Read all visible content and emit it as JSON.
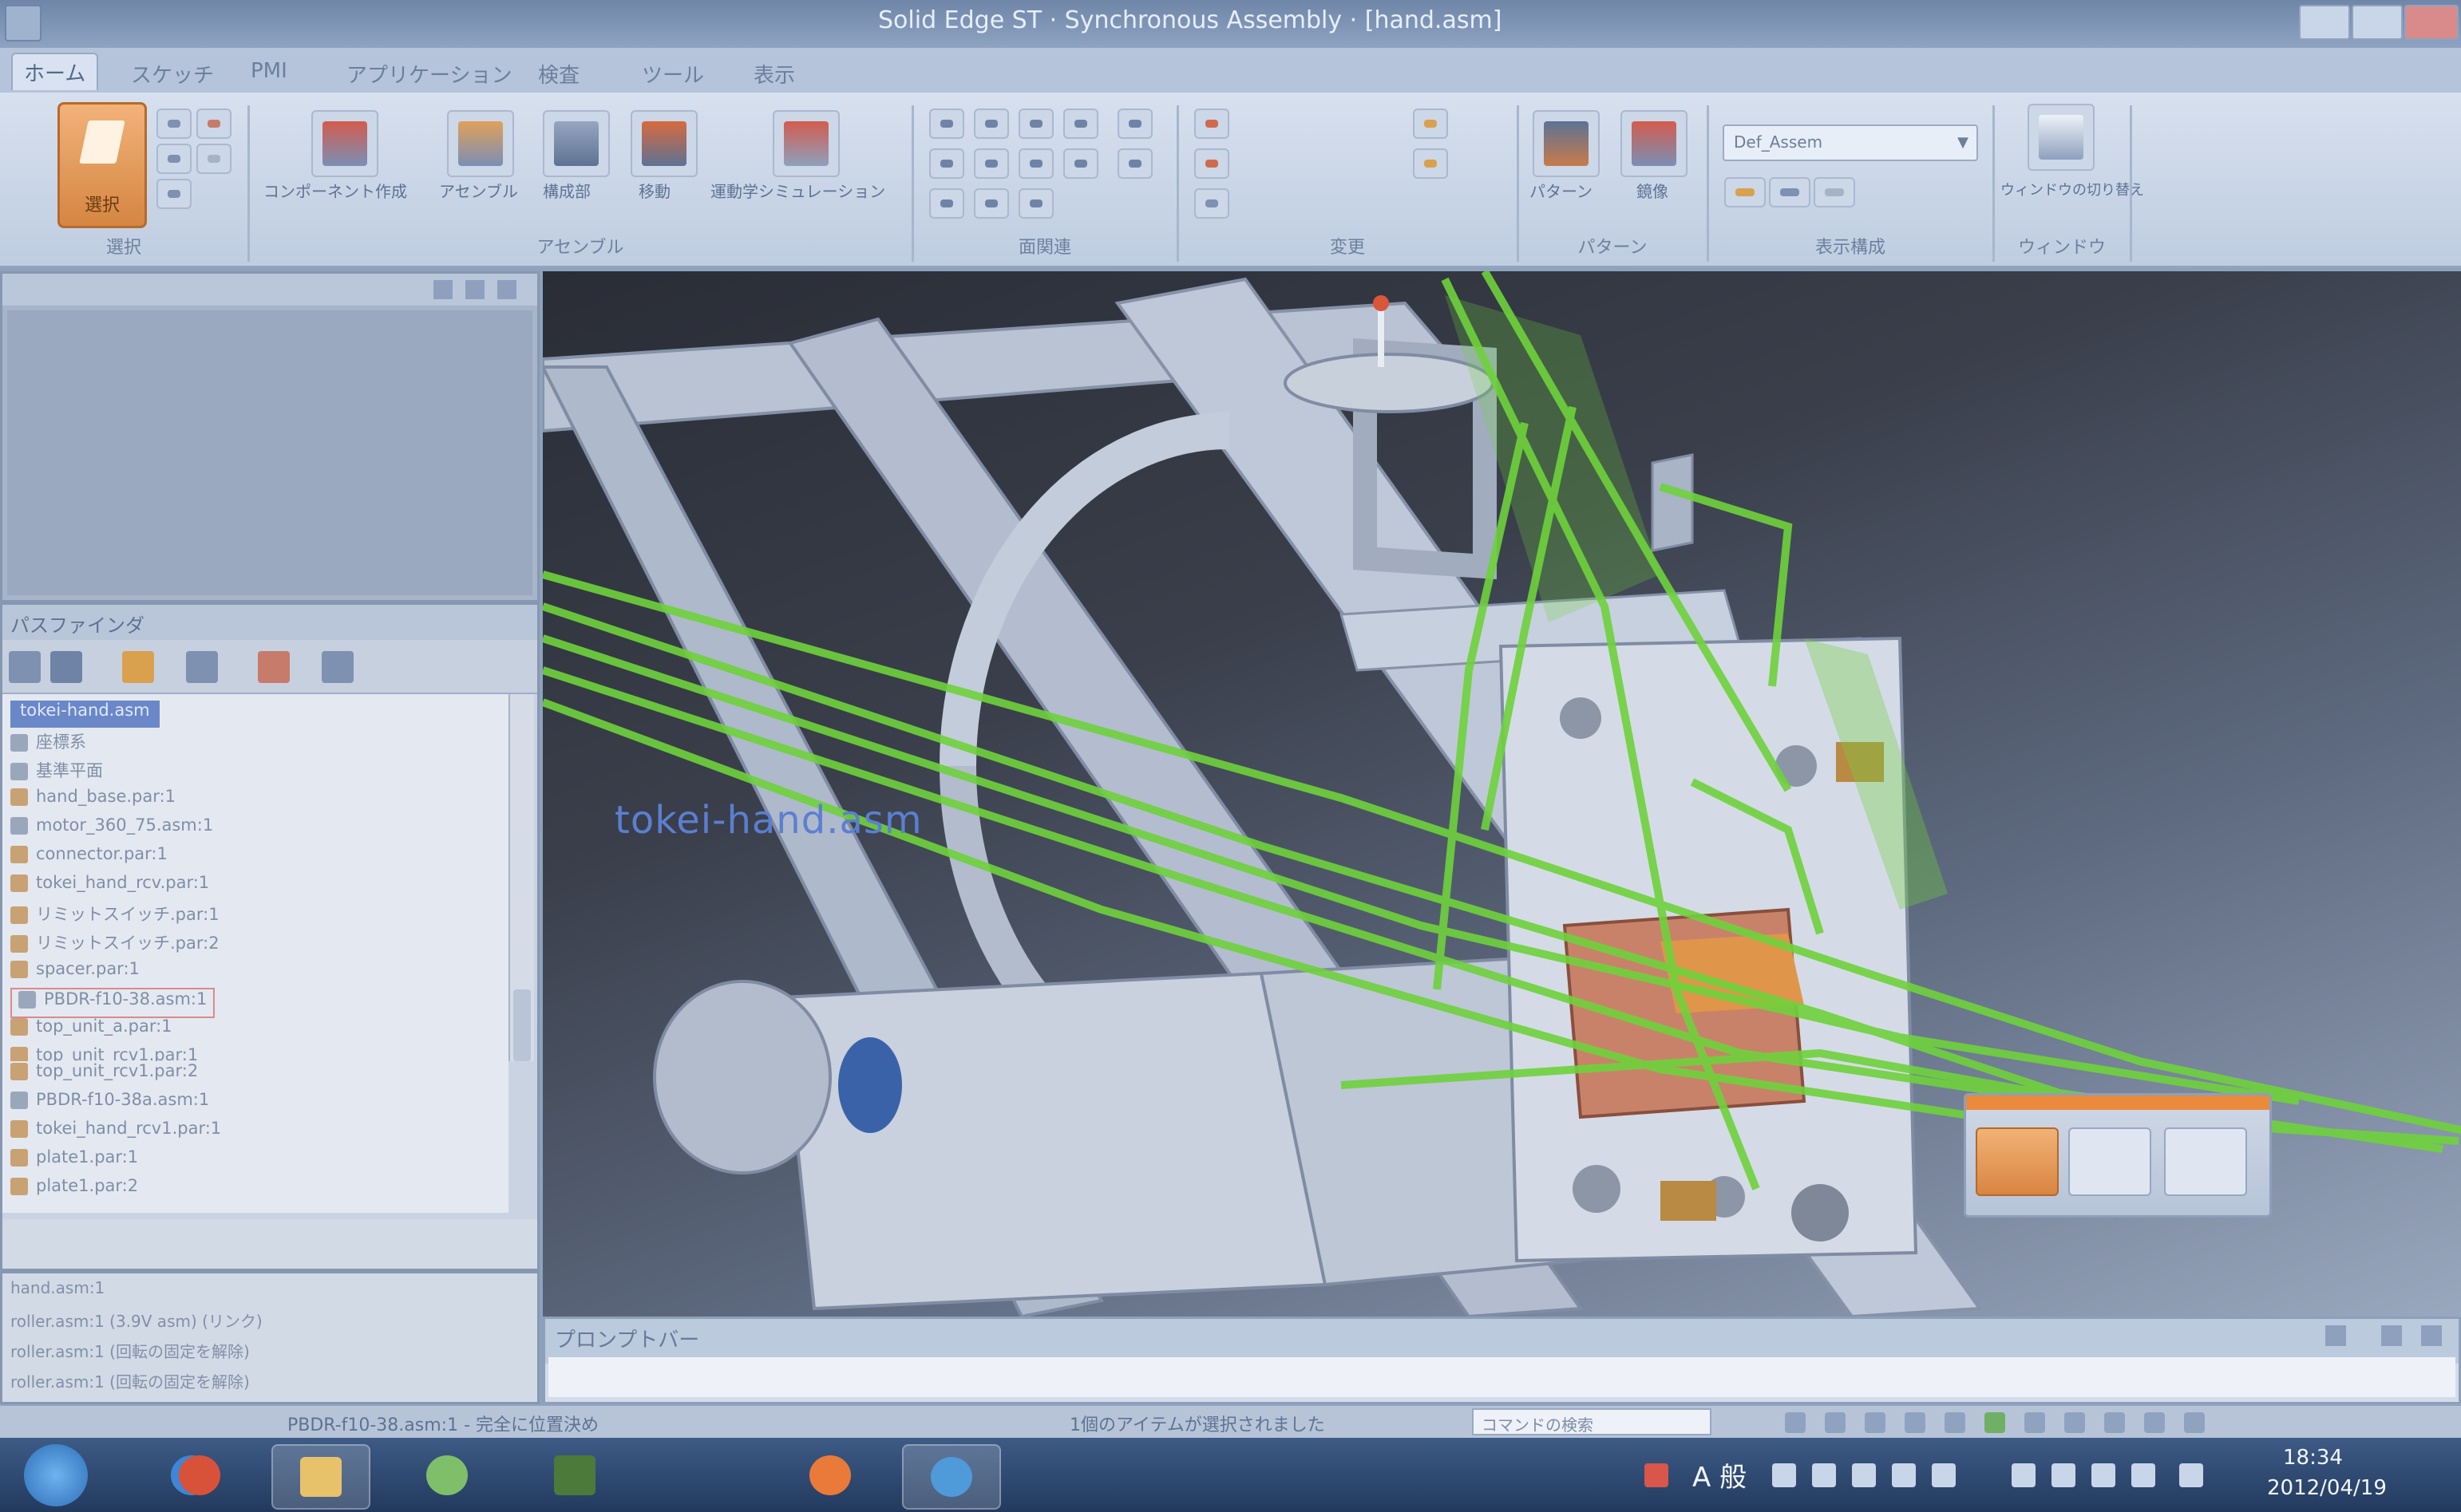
{
  "window": {
    "title": "Solid Edge ST · Synchronous Assembly · [hand.asm]"
  },
  "ribbon": {
    "tabs": [
      "ホーム",
      "スケッチ",
      "PMI",
      "アプリケーション",
      "検査",
      "ツール",
      "表示"
    ],
    "groups": {
      "select": "選択",
      "assemble": "アセンブル",
      "modify": "面関連",
      "pattern": "パターン",
      "display": "表示構成",
      "window": "ウィンドウ",
      "shape": "変更"
    },
    "buttons": {
      "select": "選択",
      "component_structure": "コンポーネント作成",
      "assemble": "アセンブル",
      "sub_assembly": "構成部",
      "move": "移動",
      "motion_simulation": "運動学シミュレーション",
      "pattern": "パターン",
      "mirror": "鏡像",
      "switch_window": "ウィンドウの切り替え"
    },
    "combo_value": "Def_Assem"
  },
  "pathfinder": {
    "header": "パスファインダ",
    "tree": [
      {
        "label": "tokei-hand.asm",
        "selected": true
      },
      {
        "label": "座標系"
      },
      {
        "label": "基準平面"
      },
      {
        "label": "hand_base.par:1"
      },
      {
        "label": "motor_360_75.asm:1"
      },
      {
        "label": "connector.par:1"
      },
      {
        "label": "tokei_hand_rcv.par:1"
      },
      {
        "label": "リミットスイッチ.par:1"
      },
      {
        "label": "リミットスイッチ.par:2"
      },
      {
        "label": "spacer.par:1"
      },
      {
        "label": "PBDR-f10-38.asm:1",
        "highlighted": true
      },
      {
        "label": "top_unit_a.par:1"
      },
      {
        "label": "top_unit_rcv1.par:1"
      },
      {
        "label": "top_unit_rcv1.par:2"
      },
      {
        "label": "PBDR-f10-38a.asm:1"
      },
      {
        "label": "tokei_hand_rcv1.par:1"
      },
      {
        "label": "plate1.par:1"
      },
      {
        "label": "plate1.par:2"
      }
    ],
    "details": [
      "hand.asm:1",
      "roller.asm:1  (3.9V asm)  (リンク)",
      "roller.asm:1  (回転の固定を解除)",
      "roller.asm:1  (回転の固定を解除)"
    ]
  },
  "viewport": {
    "file_label": "tokei-hand.asm"
  },
  "prompt_bar": {
    "label": "プロンプトバー"
  },
  "status_bar": {
    "left_text": "PBDR-f10-38.asm:1 - 完全に位置決め",
    "selection_text": "1個のアイテムが選択されました",
    "command_search_placeholder": "コマンドの検索"
  },
  "taskbar": {
    "ime": "A 般",
    "time": "18:34",
    "date": "2012/04/19"
  },
  "colors": {
    "accent_orange": "#e98a3c",
    "highlight_green": "#6fd23c",
    "selection_blue": "#6a87c8"
  }
}
